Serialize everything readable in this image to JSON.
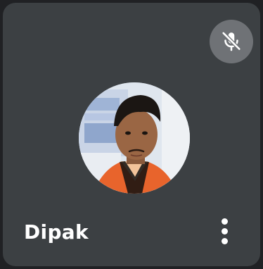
{
  "participant": {
    "name": "Dipak",
    "mic_icon": "mic-off-icon",
    "more_icon": "more-vert-icon"
  },
  "colors": {
    "tile_background": "#3c4043",
    "mute_button": "#6f7276",
    "text": "#ffffff"
  }
}
